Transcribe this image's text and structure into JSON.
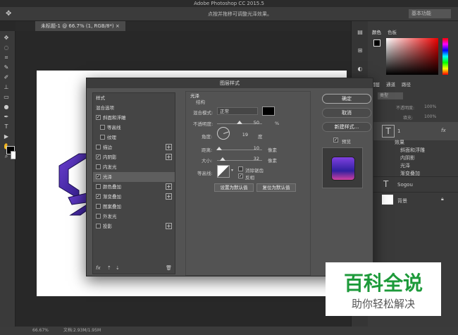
{
  "app": {
    "title": "Adobe Photoshop CC 2015.5",
    "hint": "点按并拖移可调整光泽效果。",
    "workspace": "基本功能"
  },
  "doc": {
    "tab": "未标题-1 @ 66.7% (1, RGB/8*)",
    "tab_close": "×",
    "zoom": "66.67%",
    "info": "文档:2.93M/1.95M"
  },
  "panels": {
    "color_tab": "颜色",
    "swatch_tab": "色板",
    "layers_tab": "图层",
    "channels_tab": "通道",
    "paths_tab": "路径",
    "kind": "类型",
    "opacity_label": "不透明度:",
    "opacity": "100%",
    "fill_label": "填充:",
    "fill": "100%",
    "layers": [
      {
        "name": "1",
        "type": "T",
        "fx": "fx"
      },
      {
        "name": "效果"
      },
      {
        "name": "斜面和浮雕"
      },
      {
        "name": "内阴影"
      },
      {
        "name": "光泽"
      },
      {
        "name": "渐变叠加"
      },
      {
        "name": "Sogou",
        "type": "T"
      },
      {
        "name": "背景"
      }
    ]
  },
  "dialog": {
    "title": "图层样式",
    "styles_header": "样式",
    "blend_options": "混合选项",
    "items": [
      {
        "label": "斜面和浮雕",
        "checked": true
      },
      {
        "label": "等高线",
        "checked": false
      },
      {
        "label": "纹理",
        "checked": false
      },
      {
        "label": "描边",
        "checked": false,
        "plus": "+"
      },
      {
        "label": "内阴影",
        "checked": true,
        "plus": "+"
      },
      {
        "label": "内发光",
        "checked": false
      },
      {
        "label": "光泽",
        "checked": true
      },
      {
        "label": "颜色叠加",
        "checked": false,
        "plus": "+"
      },
      {
        "label": "渐变叠加",
        "checked": true,
        "plus": "+"
      },
      {
        "label": "图案叠加",
        "checked": false
      },
      {
        "label": "外发光",
        "checked": false
      },
      {
        "label": "投影",
        "checked": false,
        "plus": "+"
      }
    ],
    "section": "光泽",
    "structure": "结构",
    "blend_mode_label": "混合模式:",
    "blend_mode": "正常",
    "opacity_label": "不透明度:",
    "opacity": "50",
    "opacity_unit": "%",
    "opacity_frac": 0.5,
    "angle_label": "角度:",
    "angle": "19",
    "angle_unit": "度",
    "distance_label": "距离:",
    "distance": "10",
    "distance_unit": "像素",
    "distance_frac": 0.04,
    "size_label": "大小:",
    "size": "32",
    "size_unit": "像素",
    "size_frac": 0.13,
    "contour_label": "等高线:",
    "antialias": "消除锯齿",
    "invert": "反相",
    "make_default": "设置为默认值",
    "reset_default": "复位为默认值",
    "ok": "确定",
    "cancel": "取消",
    "new_style": "新建样式...",
    "preview": "预览",
    "fx": "fx"
  },
  "watermark": {
    "title": "百科全说",
    "sub": "助你轻松解决"
  }
}
